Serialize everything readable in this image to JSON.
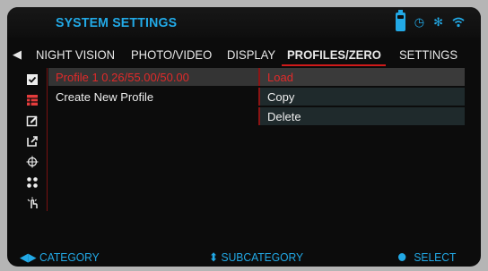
{
  "header": {
    "title": "SYSTEM SETTINGS",
    "status_icons": [
      "battery-icon",
      "timer-icon",
      "bluetooth-icon",
      "wifi-icon"
    ]
  },
  "tabs": [
    {
      "label": "NIGHT VISION"
    },
    {
      "label": "PHOTO/VIDEO"
    },
    {
      "label": "DISPLAY"
    },
    {
      "label": "PROFILES/ZERO",
      "active": true
    },
    {
      "label": "SETTINGS"
    }
  ],
  "rail_icons": [
    {
      "icon": "checkbox-icon",
      "glyph": "✓"
    },
    {
      "icon": "profile-grid-icon",
      "glyph": "▦",
      "active": true
    },
    {
      "icon": "edit-icon",
      "glyph": "✎"
    },
    {
      "icon": "export-icon",
      "glyph": "↗"
    },
    {
      "icon": "crosshair-icon",
      "glyph": "⊕"
    },
    {
      "icon": "dots-icon",
      "glyph": "⁘"
    },
    {
      "icon": "reticle-hand-icon",
      "glyph": "☝"
    }
  ],
  "profiles": [
    {
      "label": "Profile 1 0.26/55.00/50.00",
      "selected": true
    },
    {
      "label": "Create New Profile"
    }
  ],
  "actions": [
    {
      "label": "Load",
      "selected": true
    },
    {
      "label": "Copy"
    },
    {
      "label": "Delete"
    }
  ],
  "footer": {
    "category": "CATEGORY",
    "subcategory": "SUBCATEGORY",
    "select": "SELECT"
  },
  "colors": {
    "accent": "#22a9e6",
    "highlight": "#e02a2a",
    "background": "#0c0c0c"
  }
}
